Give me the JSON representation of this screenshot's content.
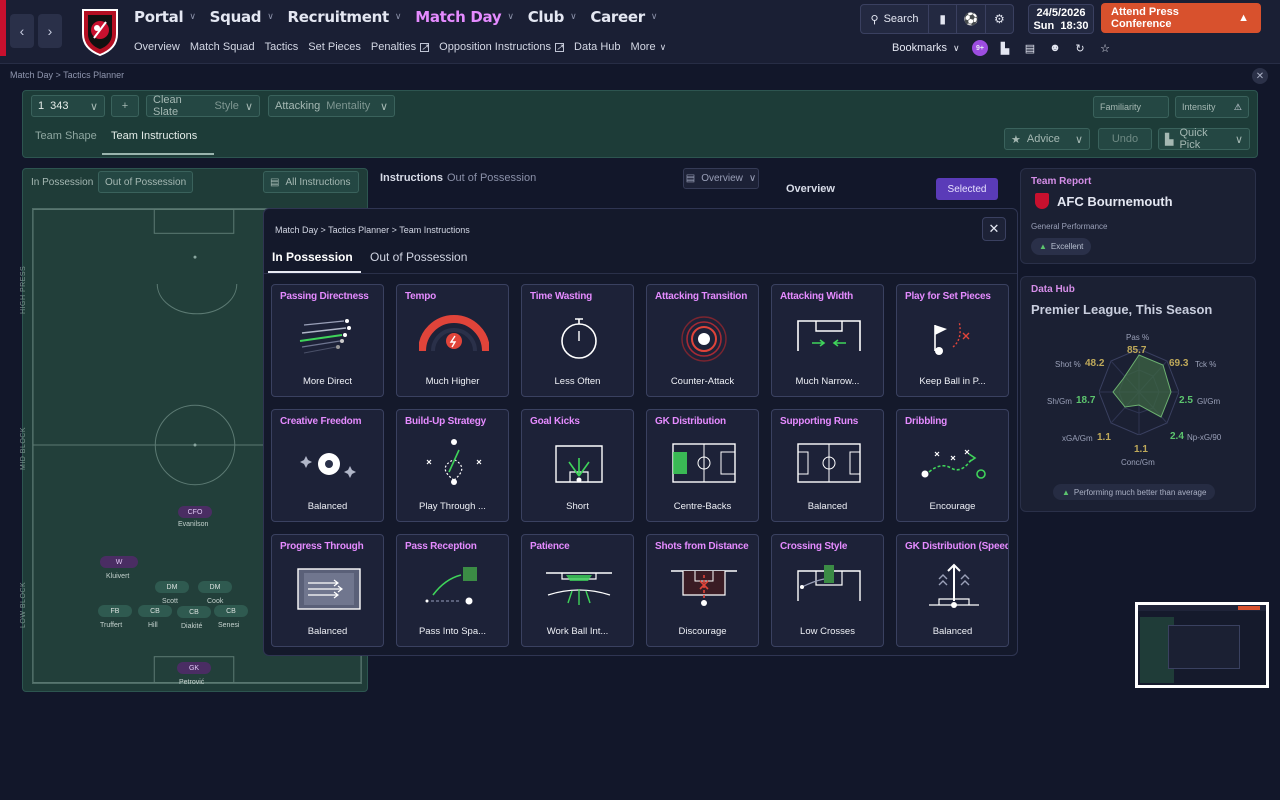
{
  "nav": {
    "items": [
      {
        "label": "Portal",
        "active": false
      },
      {
        "label": "Squad",
        "active": false
      },
      {
        "label": "Recruitment",
        "active": false
      },
      {
        "label": "Match Day",
        "active": true
      },
      {
        "label": "Club",
        "active": false
      },
      {
        "label": "Career",
        "active": false
      }
    ],
    "sub": [
      "Overview",
      "Match Squad",
      "Tactics",
      "Set Pieces",
      "Penalties",
      "Opposition Instructions",
      "Data Hub",
      "More"
    ],
    "search_label": "Search",
    "date": "24/5/2026",
    "day": "Sun",
    "time": "18:30",
    "press_button": "Attend Press Conference",
    "bookmarks": "Bookmarks",
    "badge": "9+"
  },
  "breadcrumb": "Match Day  >  Tactics Planner",
  "tactics": {
    "formation_num": "1",
    "formation": "343",
    "style_value": "Clean Slate",
    "style_label": "Style",
    "mentality_value": "Attacking",
    "mentality_label": "Mentality",
    "familiarity": "Familiarity",
    "intensity": "Intensity",
    "tabs": [
      "Team Shape",
      "Team Instructions"
    ],
    "advice": "Advice",
    "undo": "Undo",
    "quick_pick": "Quick Pick"
  },
  "pitch": {
    "toggle_in": "In Possession",
    "toggle_out": "Out of Possession",
    "all_instructions": "All Instructions",
    "labels": [
      "HIGH PRESS",
      "MID BLOCK",
      "LOW BLOCK"
    ],
    "players": [
      {
        "pos": "CFO",
        "name": "Evanilson"
      },
      {
        "pos": "W",
        "name": "Kluivert"
      },
      {
        "pos": "DM",
        "name": "Scott"
      },
      {
        "pos": "DM",
        "name": "Cook"
      },
      {
        "pos": "FB",
        "name": "Truffert"
      },
      {
        "pos": "CB",
        "name": "Hill"
      },
      {
        "pos": "CB",
        "name": "Diakité"
      },
      {
        "pos": "CB",
        "name": "Senesi"
      },
      {
        "pos": "GK",
        "name": "Petrović"
      }
    ]
  },
  "middle": {
    "title": "Instructions",
    "subtitle": "Out of Possession",
    "overview_select": "Overview",
    "overview_label": "Overview",
    "selected": "Selected"
  },
  "right": {
    "team_report": "Team Report",
    "club": "AFC Bournemouth",
    "general_performance": "General Performance",
    "excellent": "Excellent",
    "data_hub": "Data Hub",
    "league": "Premier League, This Season",
    "radar": [
      {
        "label": "Pas %",
        "value": "85.7"
      },
      {
        "label": "Tck %",
        "value": "69.3"
      },
      {
        "label": "Gl/Gm",
        "value": "2.5"
      },
      {
        "label": "Np-xG/90",
        "value": "2.4"
      },
      {
        "label": "Conc/Gm",
        "value": "1.1"
      },
      {
        "label": "xGA/Gm",
        "value": "1.1"
      },
      {
        "label": "Sh/Gm",
        "value": "18.7"
      },
      {
        "label": "Shot %",
        "value": "48.2"
      }
    ],
    "performing": "Performing much better than average"
  },
  "modal": {
    "breadcrumb": "Match Day  >  Tactics Planner  >  Team Instructions",
    "tab_in": "In Possession",
    "tab_out": "Out of Possession",
    "cards": [
      {
        "title": "Passing Directness",
        "value": "More Direct",
        "icon": "passing-directness-icon"
      },
      {
        "title": "Tempo",
        "value": "Much Higher",
        "icon": "tempo-gauge-icon"
      },
      {
        "title": "Time Wasting",
        "value": "Less Often",
        "icon": "stopwatch-icon"
      },
      {
        "title": "Attacking Transition",
        "value": "Counter-Attack",
        "icon": "target-rings-icon"
      },
      {
        "title": "Attacking Width",
        "value": "Much Narrow...",
        "icon": "width-narrow-icon"
      },
      {
        "title": "Play for Set Pieces",
        "value": "Keep Ball in P...",
        "icon": "corner-flag-icon"
      },
      {
        "title": "Creative Freedom",
        "value": "Balanced",
        "icon": "sparkle-ball-icon"
      },
      {
        "title": "Build-Up Strategy",
        "value": "Play Through ...",
        "icon": "build-up-icon"
      },
      {
        "title": "Goal Kicks",
        "value": "Short",
        "icon": "goal-kick-icon"
      },
      {
        "title": "GK Distribution",
        "value": "Centre-Backs",
        "icon": "gk-distribution-icon"
      },
      {
        "title": "Supporting Runs",
        "value": "Balanced",
        "icon": "supporting-runs-icon"
      },
      {
        "title": "Dribbling",
        "value": "Encourage",
        "icon": "dribbling-icon"
      },
      {
        "title": "Progress Through",
        "value": "Balanced",
        "icon": "progress-through-icon"
      },
      {
        "title": "Pass Reception",
        "value": "Pass Into Spa...",
        "icon": "pass-reception-icon"
      },
      {
        "title": "Patience",
        "value": "Work Ball Int...",
        "icon": "patience-icon"
      },
      {
        "title": "Shots from Distance",
        "value": "Discourage",
        "icon": "shots-distance-icon"
      },
      {
        "title": "Crossing Style",
        "value": "Low Crosses",
        "icon": "crossing-icon"
      },
      {
        "title": "GK Distribution (Speed",
        "value": "Balanced",
        "icon": "gk-speed-icon"
      }
    ]
  },
  "colors": {
    "accent_purple": "#e58bff",
    "green": "#3fd45a",
    "red": "#e0443a",
    "press": "#d8512d"
  }
}
